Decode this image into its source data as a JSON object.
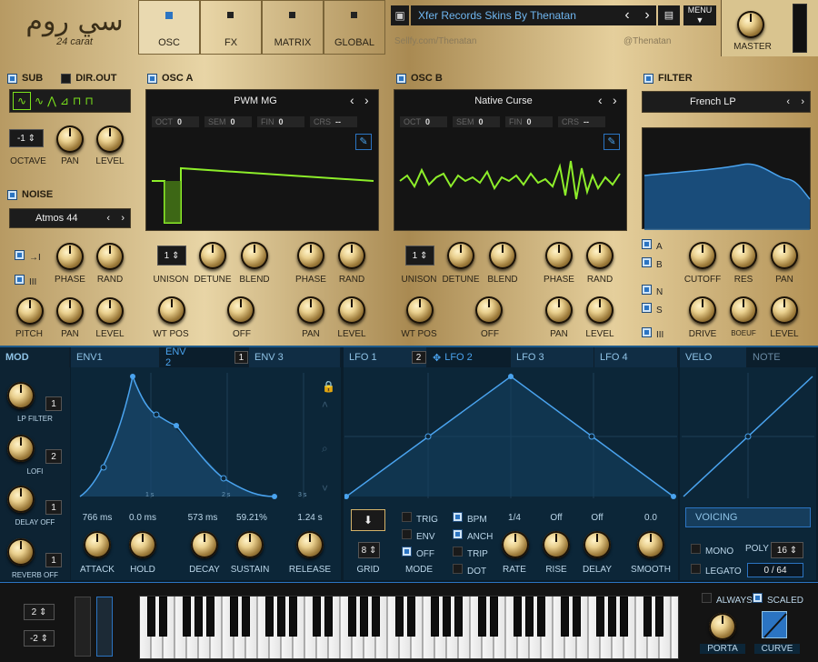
{
  "logo": {
    "text": "سي روم",
    "sub": "24 carat"
  },
  "nav_tabs": [
    "OSC",
    "FX",
    "MATRIX",
    "GLOBAL"
  ],
  "preset": {
    "name": "Xfer Records Skins By Thenatan",
    "url": "Sellfy.com/Thenatan",
    "handle": "@Thenatan",
    "menu": "MENU",
    "master": "MASTER"
  },
  "sub": {
    "title": "SUB",
    "dirout": "DIR.OUT",
    "octave": "-1",
    "labels": [
      "OCTAVE",
      "PAN",
      "LEVEL"
    ]
  },
  "noise": {
    "title": "NOISE",
    "preset": "Atmos 44",
    "labels": [
      "PHASE",
      "RAND",
      "PITCH",
      "PAN",
      "LEVEL"
    ]
  },
  "osca": {
    "title": "OSC A",
    "wave": "PWM MG",
    "params": [
      {
        "k": "OCT",
        "v": "0"
      },
      {
        "k": "SEM",
        "v": "0"
      },
      {
        "k": "FIN",
        "v": "0"
      },
      {
        "k": "CRS",
        "v": "--"
      }
    ],
    "unison": "1",
    "labels": [
      "UNISON",
      "DETUNE",
      "BLEND",
      "PHASE",
      "RAND",
      "WT POS",
      "OFF",
      "PAN",
      "LEVEL"
    ]
  },
  "oscb": {
    "title": "OSC B",
    "wave": "Native Curse",
    "params": [
      {
        "k": "OCT",
        "v": "0"
      },
      {
        "k": "SEM",
        "v": "0"
      },
      {
        "k": "FIN",
        "v": "0"
      },
      {
        "k": "CRS",
        "v": "--"
      }
    ],
    "unison": "1",
    "labels": [
      "UNISON",
      "DETUNE",
      "BLEND",
      "PHASE",
      "RAND",
      "WT POS",
      "OFF",
      "PAN",
      "LEVEL"
    ]
  },
  "filter": {
    "title": "FILTER",
    "type": "French LP",
    "routes": [
      "A",
      "B",
      "N",
      "S"
    ],
    "labels": [
      "CUTOFF",
      "RES",
      "PAN",
      "DRIVE",
      "BOEUF",
      "LEVEL"
    ]
  },
  "mod": {
    "title": "MOD",
    "slots": [
      {
        "label": "LP FILTER",
        "n": "1"
      },
      {
        "label": "LOFI",
        "n": "2"
      },
      {
        "label": "DELAY OFF",
        "n": "1"
      },
      {
        "label": "REVERB OFF",
        "n": "1"
      }
    ]
  },
  "env_tabs": [
    {
      "label": "ENV1",
      "n": ""
    },
    {
      "label": "ENV 2",
      "n": "1"
    },
    {
      "label": "ENV 3",
      "n": ""
    }
  ],
  "env_grid": [
    "1 s",
    "2 s",
    "3 s"
  ],
  "env_values": [
    "766 ms",
    "0.0 ms",
    "573 ms",
    "59.21%",
    "1.24 s"
  ],
  "env_labels": [
    "ATTACK",
    "HOLD",
    "DECAY",
    "SUSTAIN",
    "RELEASE"
  ],
  "lfo_tabs": [
    {
      "label": "LFO 1",
      "n": "2"
    },
    {
      "label": "LFO 2",
      "n": ""
    },
    {
      "label": "LFO 3",
      "n": ""
    },
    {
      "label": "LFO 4",
      "n": ""
    }
  ],
  "lfo": {
    "grid": "8",
    "grid_label": "GRID",
    "mode_label": "MODE",
    "modes": [
      "TRIG",
      "ENV",
      "OFF"
    ],
    "opts": [
      "BPM",
      "ANCH",
      "TRIP",
      "DOT"
    ],
    "values": [
      "1/4",
      "Off",
      "Off",
      "0.0"
    ],
    "labels": [
      "RATE",
      "RISE",
      "DELAY",
      "SMOOTH"
    ]
  },
  "velo_tabs": [
    "VELO",
    "NOTE"
  ],
  "voicing": {
    "title": "VOICING",
    "mono": "MONO",
    "legato": "LEGATO",
    "poly": "POLY",
    "poly_v": "16",
    "count": "0 / 64"
  },
  "keys": {
    "bend_up": "2",
    "bend_down": "-2",
    "always": "ALWAYS",
    "scaled": "SCALED",
    "porta": "PORTA",
    "curve": "CURVE"
  }
}
